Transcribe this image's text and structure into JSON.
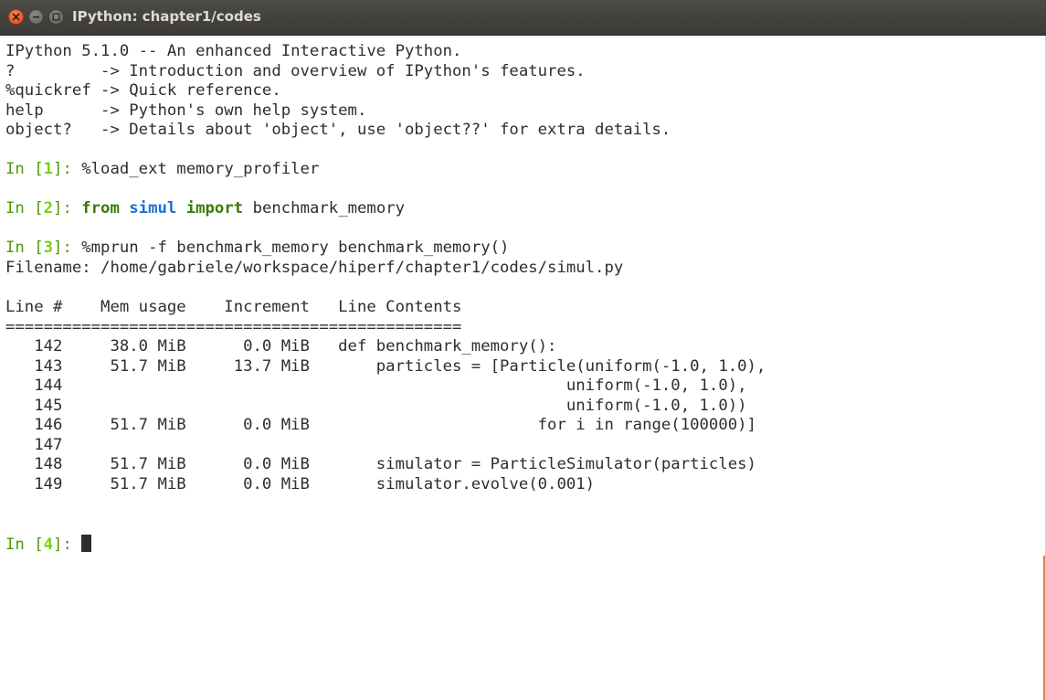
{
  "window": {
    "title": "IPython: chapter1/codes",
    "buttons": [
      "close-icon",
      "minimize-icon",
      "maximize-icon"
    ],
    "colors": {
      "titlebar": "#3f3e3a",
      "close": "#dd4814",
      "prompt": "#4e9a06",
      "prompt_number": "#73d216",
      "module": "#1b6fd4"
    }
  },
  "banner": [
    "IPython 5.1.0 -- An enhanced Interactive Python.",
    "?         -> Introduction and overview of IPython's features.",
    "%quickref -> Quick reference.",
    "help      -> Python's own help system.",
    "object?   -> Details about 'object', use 'object??' for extra details."
  ],
  "prompt": {
    "in_pre": "In [",
    "in_post": "]: "
  },
  "cells": [
    {
      "number": "1",
      "code": "%load_ext memory_profiler"
    },
    {
      "number": "2",
      "kw1": "from",
      "module": "simul",
      "kw2": "import",
      "rest": "benchmark_memory"
    },
    {
      "number": "3",
      "code": "%mprun -f benchmark_memory benchmark_memory()"
    },
    {
      "number": "4"
    }
  ],
  "output": {
    "filename": "Filename: /home/gabriele/workspace/hiperf/chapter1/codes/simul.py",
    "header": "Line #    Mem usage    Increment   Line Contents",
    "separator": "================================================",
    "rows": [
      "   142     38.0 MiB      0.0 MiB   def benchmark_memory():",
      "   143     51.7 MiB     13.7 MiB       particles = [Particle(uniform(-1.0, 1.0),",
      "   144                                                     uniform(-1.0, 1.0),",
      "   145                                                     uniform(-1.0, 1.0))",
      "   146     51.7 MiB      0.0 MiB                        for i in range(100000)]",
      "   147",
      "   148     51.7 MiB      0.0 MiB       simulator = ParticleSimulator(particles)",
      "   149     51.7 MiB      0.0 MiB       simulator.evolve(0.001)"
    ]
  }
}
